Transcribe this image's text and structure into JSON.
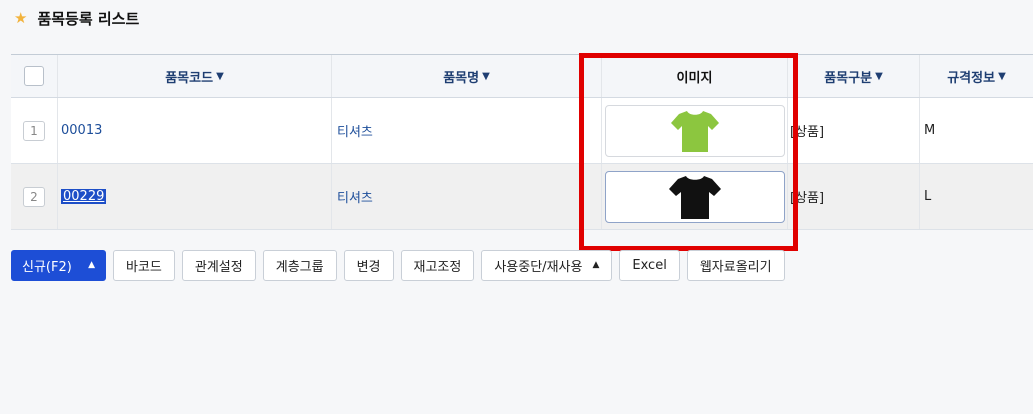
{
  "page": {
    "title": "품목등록 리스트"
  },
  "colors": {
    "accent": "#1d4ed6",
    "highlight": "#e00000",
    "star": "#f2b33d"
  },
  "grid": {
    "columns": [
      {
        "label": "품목코드",
        "sortable": true
      },
      {
        "label": "품목명",
        "sortable": true
      },
      {
        "label": "이미지",
        "sortable": false
      },
      {
        "label": "품목구분",
        "sortable": true
      },
      {
        "label": "규격정보",
        "sortable": true
      }
    ],
    "rows": [
      {
        "num": "1",
        "code": "00013",
        "name": "티셔츠",
        "image": "green-tshirt",
        "category": "[상품]",
        "spec": "M"
      },
      {
        "num": "2",
        "code": "00229",
        "name": "티셔츠",
        "image": "black-tshirt",
        "category": "[상품]",
        "spec": "L"
      }
    ]
  },
  "toolbar": {
    "new_label": "신규(F2)",
    "barcode_label": "바코드",
    "relation_label": "관계설정",
    "hierarchy_label": "계층그룹",
    "change_label": "변경",
    "stock_label": "재고조정",
    "suspend_label": "사용중단/재사용",
    "excel_label": "Excel",
    "upload_label": "웹자료올리기"
  }
}
